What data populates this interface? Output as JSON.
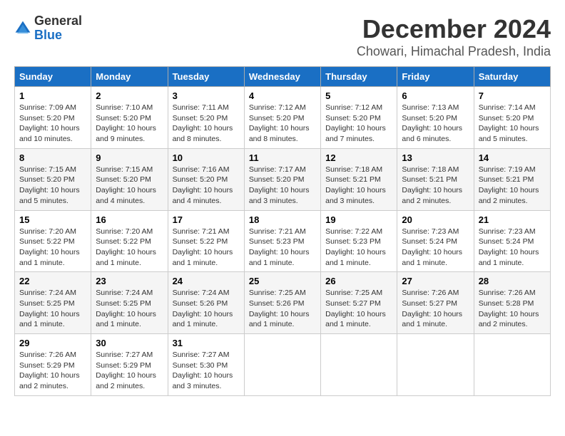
{
  "header": {
    "logo_general": "General",
    "logo_blue": "Blue",
    "month_title": "December 2024",
    "location": "Chowari, Himachal Pradesh, India"
  },
  "calendar": {
    "weekdays": [
      "Sunday",
      "Monday",
      "Tuesday",
      "Wednesday",
      "Thursday",
      "Friday",
      "Saturday"
    ],
    "weeks": [
      [
        null,
        null,
        null,
        null,
        null,
        null,
        null
      ]
    ],
    "days": {
      "1": {
        "sunrise": "7:09 AM",
        "sunset": "5:20 PM",
        "daylight": "10 hours and 10 minutes."
      },
      "2": {
        "sunrise": "7:10 AM",
        "sunset": "5:20 PM",
        "daylight": "10 hours and 9 minutes."
      },
      "3": {
        "sunrise": "7:11 AM",
        "sunset": "5:20 PM",
        "daylight": "10 hours and 8 minutes."
      },
      "4": {
        "sunrise": "7:12 AM",
        "sunset": "5:20 PM",
        "daylight": "10 hours and 8 minutes."
      },
      "5": {
        "sunrise": "7:12 AM",
        "sunset": "5:20 PM",
        "daylight": "10 hours and 7 minutes."
      },
      "6": {
        "sunrise": "7:13 AM",
        "sunset": "5:20 PM",
        "daylight": "10 hours and 6 minutes."
      },
      "7": {
        "sunrise": "7:14 AM",
        "sunset": "5:20 PM",
        "daylight": "10 hours and 5 minutes."
      },
      "8": {
        "sunrise": "7:15 AM",
        "sunset": "5:20 PM",
        "daylight": "10 hours and 5 minutes."
      },
      "9": {
        "sunrise": "7:15 AM",
        "sunset": "5:20 PM",
        "daylight": "10 hours and 4 minutes."
      },
      "10": {
        "sunrise": "7:16 AM",
        "sunset": "5:20 PM",
        "daylight": "10 hours and 4 minutes."
      },
      "11": {
        "sunrise": "7:17 AM",
        "sunset": "5:20 PM",
        "daylight": "10 hours and 3 minutes."
      },
      "12": {
        "sunrise": "7:18 AM",
        "sunset": "5:21 PM",
        "daylight": "10 hours and 3 minutes."
      },
      "13": {
        "sunrise": "7:18 AM",
        "sunset": "5:21 PM",
        "daylight": "10 hours and 2 minutes."
      },
      "14": {
        "sunrise": "7:19 AM",
        "sunset": "5:21 PM",
        "daylight": "10 hours and 2 minutes."
      },
      "15": {
        "sunrise": "7:20 AM",
        "sunset": "5:22 PM",
        "daylight": "10 hours and 1 minute."
      },
      "16": {
        "sunrise": "7:20 AM",
        "sunset": "5:22 PM",
        "daylight": "10 hours and 1 minute."
      },
      "17": {
        "sunrise": "7:21 AM",
        "sunset": "5:22 PM",
        "daylight": "10 hours and 1 minute."
      },
      "18": {
        "sunrise": "7:21 AM",
        "sunset": "5:23 PM",
        "daylight": "10 hours and 1 minute."
      },
      "19": {
        "sunrise": "7:22 AM",
        "sunset": "5:23 PM",
        "daylight": "10 hours and 1 minute."
      },
      "20": {
        "sunrise": "7:23 AM",
        "sunset": "5:24 PM",
        "daylight": "10 hours and 1 minute."
      },
      "21": {
        "sunrise": "7:23 AM",
        "sunset": "5:24 PM",
        "daylight": "10 hours and 1 minute."
      },
      "22": {
        "sunrise": "7:24 AM",
        "sunset": "5:25 PM",
        "daylight": "10 hours and 1 minute."
      },
      "23": {
        "sunrise": "7:24 AM",
        "sunset": "5:25 PM",
        "daylight": "10 hours and 1 minute."
      },
      "24": {
        "sunrise": "7:24 AM",
        "sunset": "5:26 PM",
        "daylight": "10 hours and 1 minute."
      },
      "25": {
        "sunrise": "7:25 AM",
        "sunset": "5:26 PM",
        "daylight": "10 hours and 1 minute."
      },
      "26": {
        "sunrise": "7:25 AM",
        "sunset": "5:27 PM",
        "daylight": "10 hours and 1 minute."
      },
      "27": {
        "sunrise": "7:26 AM",
        "sunset": "5:27 PM",
        "daylight": "10 hours and 1 minute."
      },
      "28": {
        "sunrise": "7:26 AM",
        "sunset": "5:28 PM",
        "daylight": "10 hours and 2 minutes."
      },
      "29": {
        "sunrise": "7:26 AM",
        "sunset": "5:29 PM",
        "daylight": "10 hours and 2 minutes."
      },
      "30": {
        "sunrise": "7:27 AM",
        "sunset": "5:29 PM",
        "daylight": "10 hours and 2 minutes."
      },
      "31": {
        "sunrise": "7:27 AM",
        "sunset": "5:30 PM",
        "daylight": "10 hours and 3 minutes."
      }
    }
  }
}
